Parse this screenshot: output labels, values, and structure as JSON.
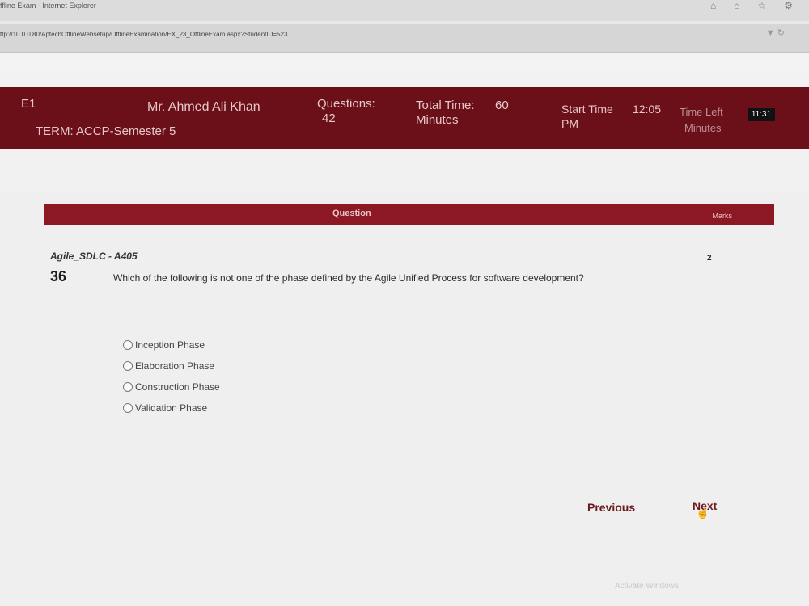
{
  "browser": {
    "title": "ffline Exam - Internet Explorer",
    "url": "ttp://10.0.0.80/AptechOfflineWebsetup/OfflineExamination/EX_23_OfflineExam.aspx?StudentID=523"
  },
  "header": {
    "center": "E1",
    "faculty": "Mr. Ahmed Ali Khan",
    "questions_label": "Questions:",
    "questions_value": "42",
    "total_time_label": "Total Time:",
    "total_time_value": "60",
    "total_time_unit": "Minutes",
    "start_time_label": "Start Time",
    "start_time_value": "12:05",
    "start_time_suffix": "PM",
    "time_left_label": "Time Left",
    "time_left_value": "11:31",
    "time_left_unit": "Minutes",
    "term": "TERM: ACCP-Semester 5"
  },
  "question_bar": {
    "question_label": "Question",
    "marks_label": "Marks"
  },
  "question": {
    "subject": "Agile_SDLC - A405",
    "number": "36",
    "marks": "2",
    "text": "Which of the following is not one of the phase defined by the Agile Unified Process for software development?",
    "options": [
      "Inception Phase",
      "Elaboration Phase",
      "Construction Phase",
      "Validation Phase"
    ]
  },
  "navigation": {
    "previous": "Previous",
    "next": "Next"
  },
  "watermark": "Activate Windows"
}
